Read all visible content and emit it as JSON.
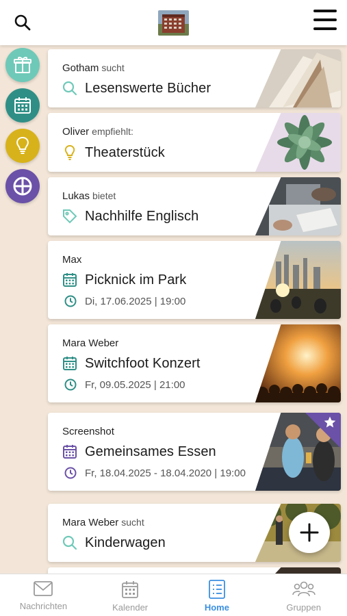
{
  "header": {
    "search_icon": "search-icon",
    "logo": "building-photo-logo",
    "menu_icon": "hamburger-menu-icon"
  },
  "side_categories": [
    {
      "icon": "gift-icon",
      "color": "#6fc9b8"
    },
    {
      "icon": "calendar-icon",
      "color": "#2f8f86"
    },
    {
      "icon": "lightbulb-icon",
      "color": "#d8b21a"
    },
    {
      "icon": "crosshair-icon",
      "color": "#6b51a7"
    }
  ],
  "cards": [
    {
      "user": "Gotham",
      "verb": "sucht",
      "title": "Lesenswerte Bücher",
      "icon": "search-icon"
    },
    {
      "user": "Oliver",
      "verb": "empfiehlt:",
      "title": "Theaterstück",
      "icon": "lightbulb-icon"
    },
    {
      "user": "Lukas",
      "verb": "bietet",
      "title": "Nachhilfe Englisch",
      "icon": "tag-icon"
    },
    {
      "user": "Max",
      "verb": "",
      "title": "Picknick im Park",
      "date": "Di, 17.06.2025 | 19:00",
      "icon": "calendar-icon"
    },
    {
      "user": "Mara Weber",
      "verb": "",
      "title": "Switchfoot Konzert",
      "date": "Fr, 09.05.2025 | 21:00",
      "icon": "calendar-icon"
    },
    {
      "user": "Screenshot",
      "verb": "",
      "title": "Gemeinsames Essen",
      "date": "Fr, 18.04.2025 - 18.04.2020 | 19:00",
      "icon": "calendar-icon",
      "starred": true
    },
    {
      "user": "Mara Weber",
      "verb": "sucht",
      "title": "Kinderwagen",
      "icon": "search-icon"
    }
  ],
  "fab": {
    "icon": "plus-icon"
  },
  "bottom_nav": [
    {
      "label": "Nachrichten",
      "icon": "envelope-icon",
      "active": false
    },
    {
      "label": "Kalender",
      "icon": "calendar-icon",
      "active": false
    },
    {
      "label": "Home",
      "icon": "list-icon",
      "active": true
    },
    {
      "label": "Gruppen",
      "icon": "group-icon",
      "active": false
    }
  ],
  "colors": {
    "background": "#f3e6d8",
    "teal": "#2f8f86",
    "mint": "#6fc9b8",
    "yellow": "#d8b21a",
    "purple": "#6b51a7",
    "active_nav": "#3b8fe0"
  }
}
